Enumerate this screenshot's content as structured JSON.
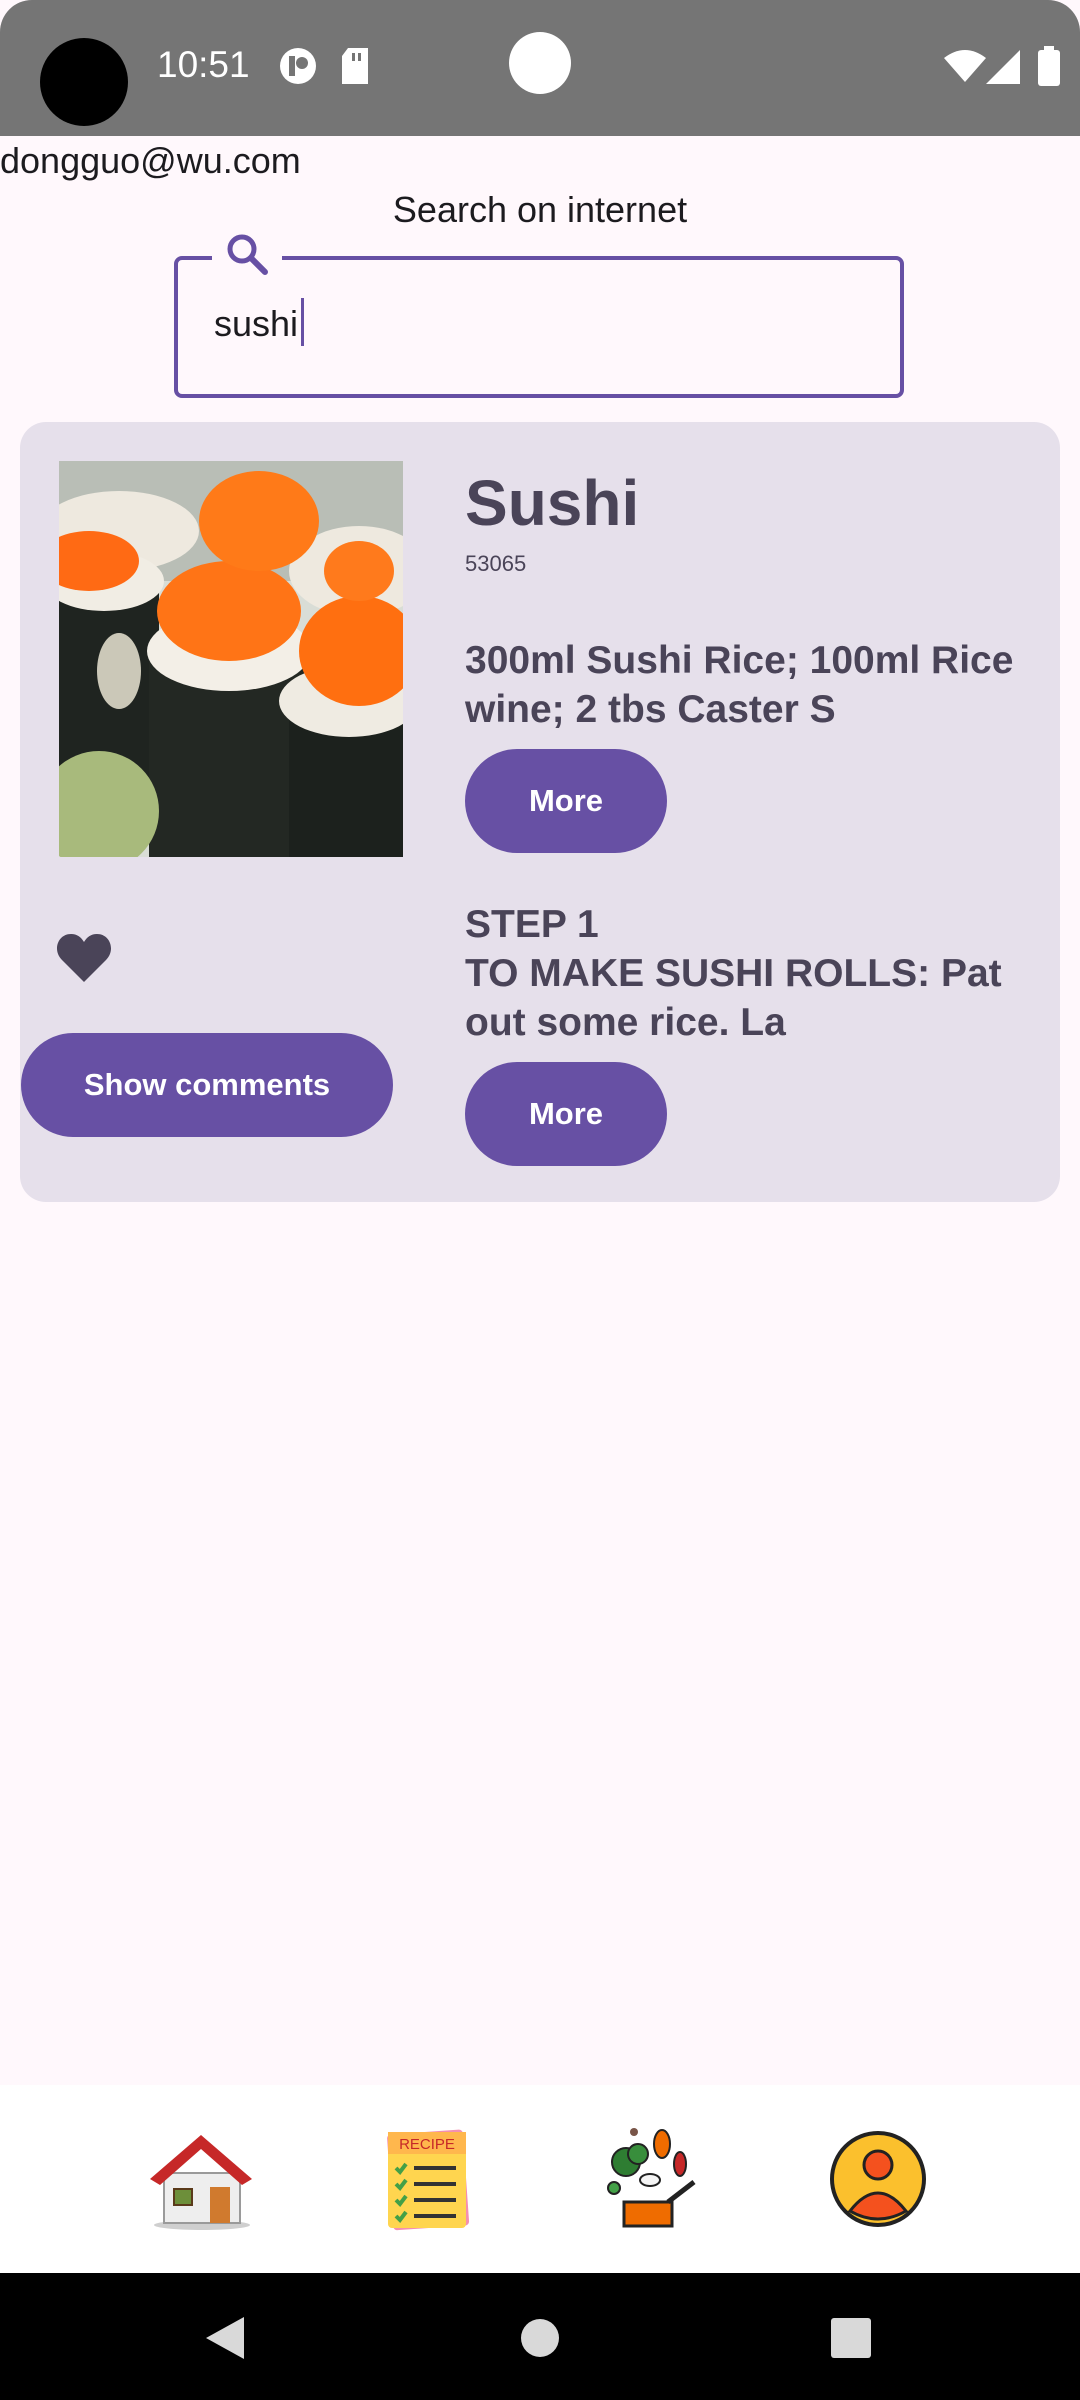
{
  "status_bar": {
    "time": "10:51"
  },
  "account": {
    "email": "dongguo@wu.com"
  },
  "search": {
    "title": "Search on internet",
    "value": "sushi"
  },
  "recipe": {
    "name": "Sushi",
    "id": "53065",
    "ingredients_preview": "300ml  Sushi Rice; 100ml Rice wine; 2 tbs Caster S",
    "steps_preview": "STEP 1\nTO MAKE SUSHI ROLLS: Pat out some rice. La",
    "more_ingredients_label": "More",
    "more_steps_label": "More",
    "show_comments_label": "Show  comments",
    "favorite_icon": "heart-icon"
  },
  "bottom_nav": {
    "items": [
      {
        "icon": "home-icon"
      },
      {
        "icon": "recipe-list-icon",
        "label": "RECIPE"
      },
      {
        "icon": "ingredients-icon"
      },
      {
        "icon": "profile-icon"
      }
    ]
  },
  "colors": {
    "accent": "#6750A4",
    "card": "#E6E0EB",
    "background": "#FFF8FC",
    "text_secondary": "#4A4458"
  }
}
